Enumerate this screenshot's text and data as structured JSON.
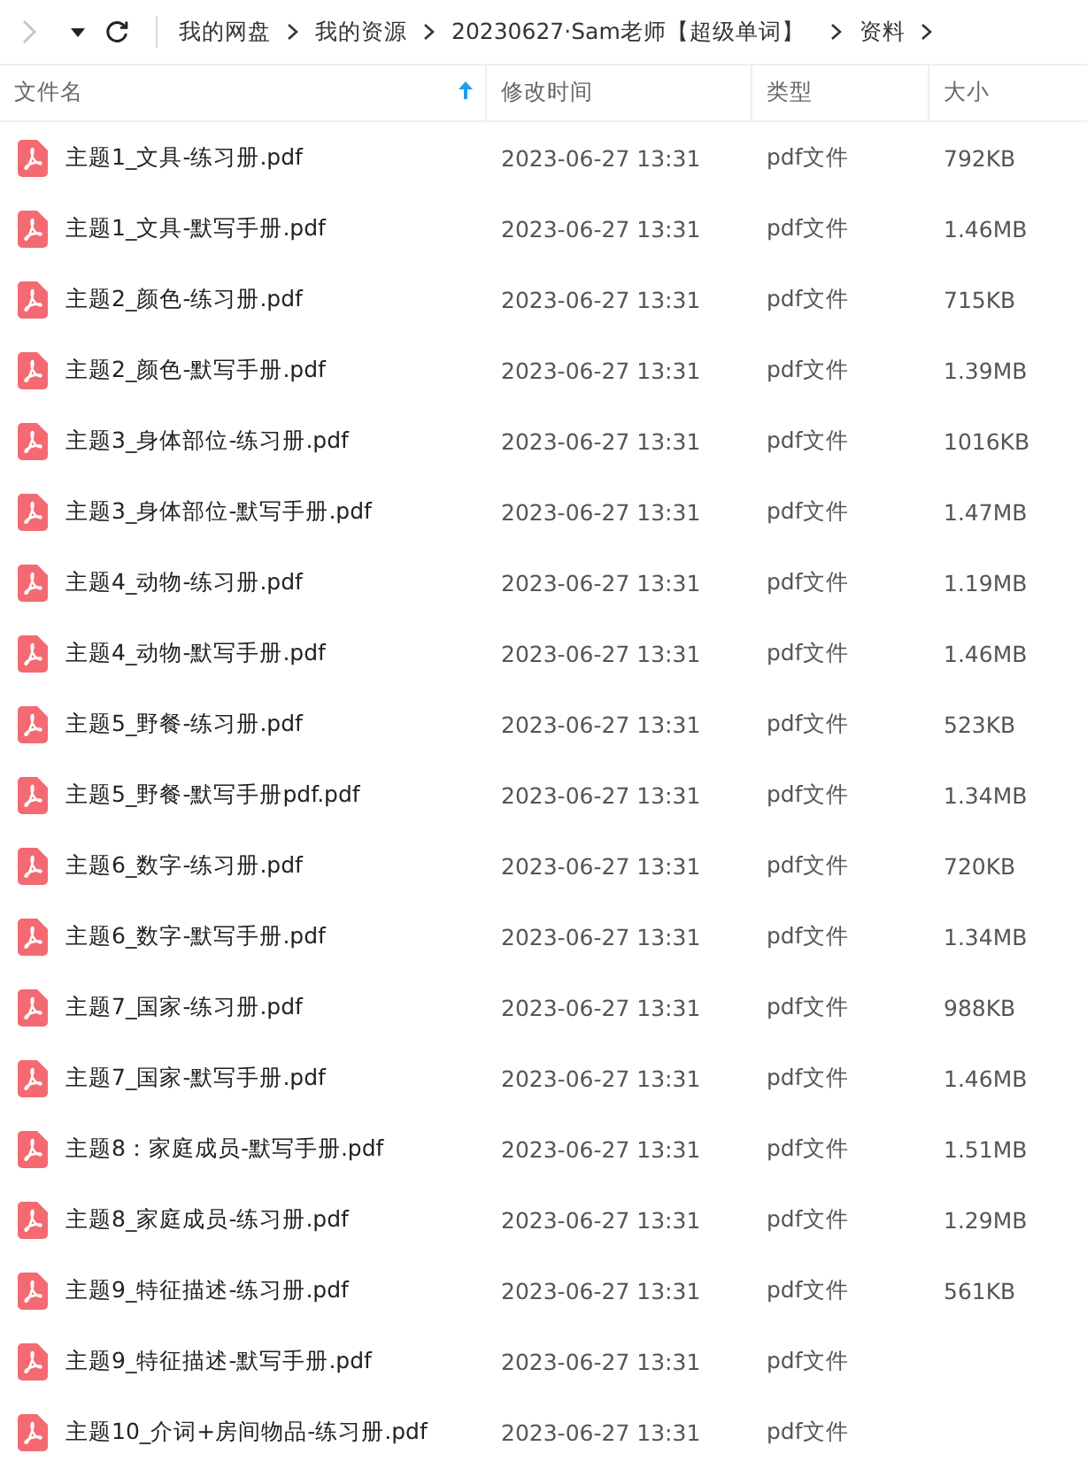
{
  "toolbar": {
    "back_disabled": true,
    "breadcrumb": [
      "我的网盘",
      "我的资源",
      "20230627·Sam老师【超级单词】",
      "资料"
    ]
  },
  "table": {
    "columns": [
      {
        "label": "文件名",
        "sorted": true
      },
      {
        "label": "修改时间",
        "sorted": false
      },
      {
        "label": "类型",
        "sorted": false
      },
      {
        "label": "大小",
        "sorted": false
      }
    ],
    "rows": [
      {
        "name": "主题1_文具-练习册.pdf",
        "modified": "2023-06-27 13:31",
        "type": "pdf文件",
        "size": "792KB"
      },
      {
        "name": "主题1_文具-默写手册.pdf",
        "modified": "2023-06-27 13:31",
        "type": "pdf文件",
        "size": "1.46MB"
      },
      {
        "name": "主题2_颜色-练习册.pdf",
        "modified": "2023-06-27 13:31",
        "type": "pdf文件",
        "size": "715KB"
      },
      {
        "name": "主题2_颜色-默写手册.pdf",
        "modified": "2023-06-27 13:31",
        "type": "pdf文件",
        "size": "1.39MB"
      },
      {
        "name": "主题3_身体部位-练习册.pdf",
        "modified": "2023-06-27 13:31",
        "type": "pdf文件",
        "size": "1016KB"
      },
      {
        "name": "主题3_身体部位-默写手册.pdf",
        "modified": "2023-06-27 13:31",
        "type": "pdf文件",
        "size": "1.47MB"
      },
      {
        "name": "主题4_动物-练习册.pdf",
        "modified": "2023-06-27 13:31",
        "type": "pdf文件",
        "size": "1.19MB"
      },
      {
        "name": "主题4_动物-默写手册.pdf",
        "modified": "2023-06-27 13:31",
        "type": "pdf文件",
        "size": "1.46MB"
      },
      {
        "name": "主题5_野餐-练习册.pdf",
        "modified": "2023-06-27 13:31",
        "type": "pdf文件",
        "size": "523KB"
      },
      {
        "name": "主题5_野餐-默写手册pdf.pdf",
        "modified": "2023-06-27 13:31",
        "type": "pdf文件",
        "size": "1.34MB"
      },
      {
        "name": "主题6_数字-练习册.pdf",
        "modified": "2023-06-27 13:31",
        "type": "pdf文件",
        "size": "720KB"
      },
      {
        "name": "主题6_数字-默写手册.pdf",
        "modified": "2023-06-27 13:31",
        "type": "pdf文件",
        "size": "1.34MB"
      },
      {
        "name": "主题7_国家-练习册.pdf",
        "modified": "2023-06-27 13:31",
        "type": "pdf文件",
        "size": "988KB"
      },
      {
        "name": "主题7_国家-默写手册.pdf",
        "modified": "2023-06-27 13:31",
        "type": "pdf文件",
        "size": "1.46MB"
      },
      {
        "name": "主题8：家庭成员-默写手册.pdf",
        "modified": "2023-06-27 13:31",
        "type": "pdf文件",
        "size": "1.51MB"
      },
      {
        "name": "主题8_家庭成员-练习册.pdf",
        "modified": "2023-06-27 13:31",
        "type": "pdf文件",
        "size": "1.29MB"
      },
      {
        "name": "主题9_特征描述-练习册.pdf",
        "modified": "2023-06-27 13:31",
        "type": "pdf文件",
        "size": "561KB"
      },
      {
        "name": "主题9_特征描述-默写手册.pdf",
        "modified": "2023-06-27 13:31",
        "type": "pdf文件"
      },
      {
        "name": "主题10_介词+房间物品-练习册.pdf",
        "modified": "2023-06-27 13:31",
        "type": "pdf文件"
      }
    ]
  }
}
